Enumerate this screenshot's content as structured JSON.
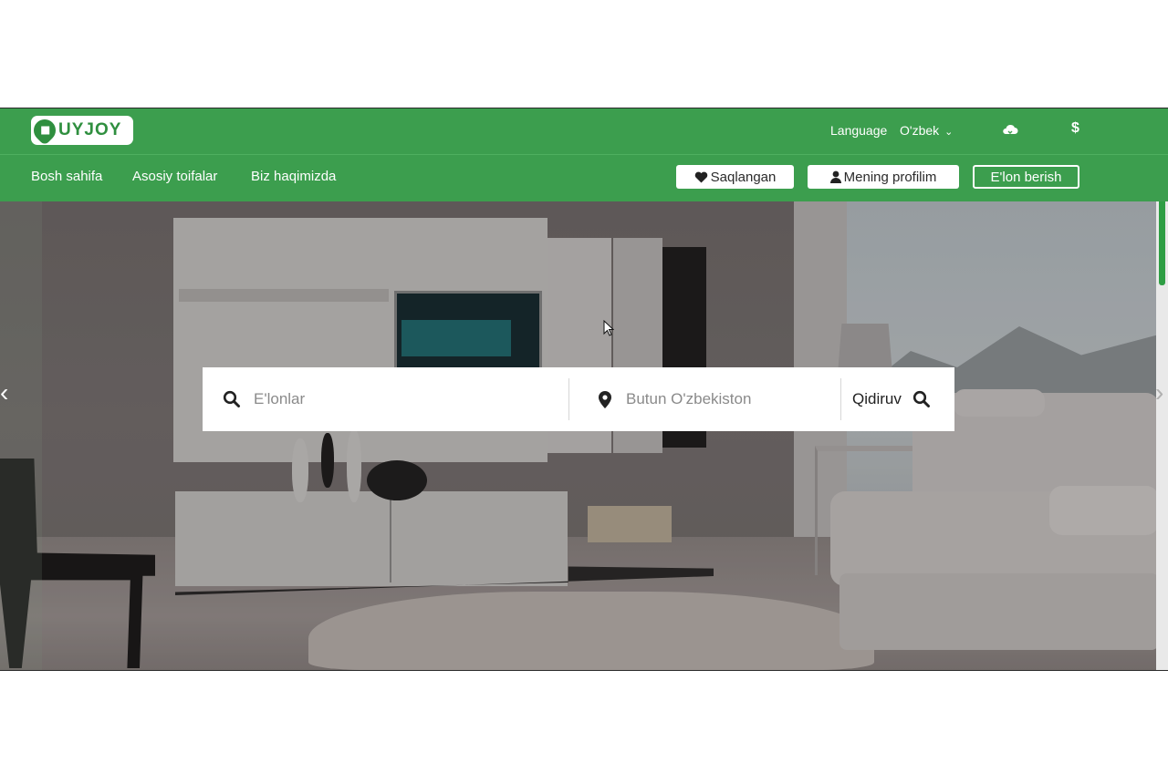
{
  "brand": {
    "logo_text": "UYJOY"
  },
  "header": {
    "language_label": "Language",
    "language_value": "O'zbek",
    "currency_symbol": "$"
  },
  "nav": {
    "items": [
      {
        "label": "Bosh sahifa"
      },
      {
        "label": "Asosiy toifalar"
      },
      {
        "label": "Biz haqimizda"
      }
    ],
    "saved_button": "Saqlangan",
    "profile_button": "Mening profilim",
    "post_ad_button": "E'lon berish"
  },
  "search": {
    "query_placeholder": "E'lonlar",
    "location_placeholder": "Butun O'zbekiston",
    "submit_label": "Qidiruv"
  },
  "colors": {
    "header_green": "#3c9e4e",
    "white": "#ffffff"
  },
  "icons": {
    "search": "search-icon",
    "location": "map-pin-icon",
    "heart": "heart-icon",
    "user": "user-icon",
    "cloud": "cloud-icon",
    "chevron": "chevron-down-icon"
  }
}
